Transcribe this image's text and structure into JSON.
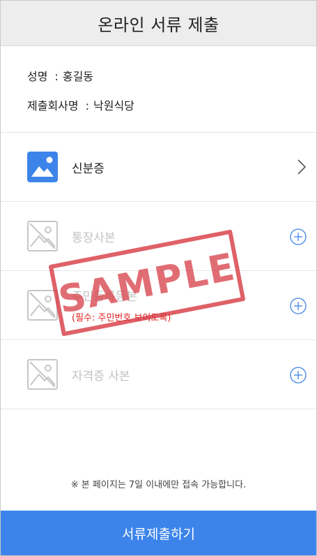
{
  "header": {
    "title": "온라인 서류 제출"
  },
  "applicant": {
    "name_label": "성명",
    "name_value": "홍길동",
    "company_label": "제출회사명",
    "company_value": "낙원식당",
    "separator": ":"
  },
  "documents": [
    {
      "label": "신분증",
      "state": "uploaded",
      "action_icon": "chevron-right-icon"
    },
    {
      "label": "통장사본",
      "state": "empty",
      "action_icon": "plus-circle-icon"
    },
    {
      "label": "주민등록등본",
      "state": "empty",
      "note": "(필수: 주민번호 보이도록)",
      "action_icon": "plus-circle-icon"
    },
    {
      "label": "자격증 사본",
      "state": "empty",
      "action_icon": "plus-circle-icon"
    }
  ],
  "footnote": "※ 본 페이지는 7일 이내에만 접속 가능합니다.",
  "submit": {
    "label": "서류제출하기"
  },
  "watermark": "SAMPLE",
  "colors": {
    "accent": "#3d84ea",
    "warning": "#e0201b",
    "stamp": "#d6343e"
  }
}
